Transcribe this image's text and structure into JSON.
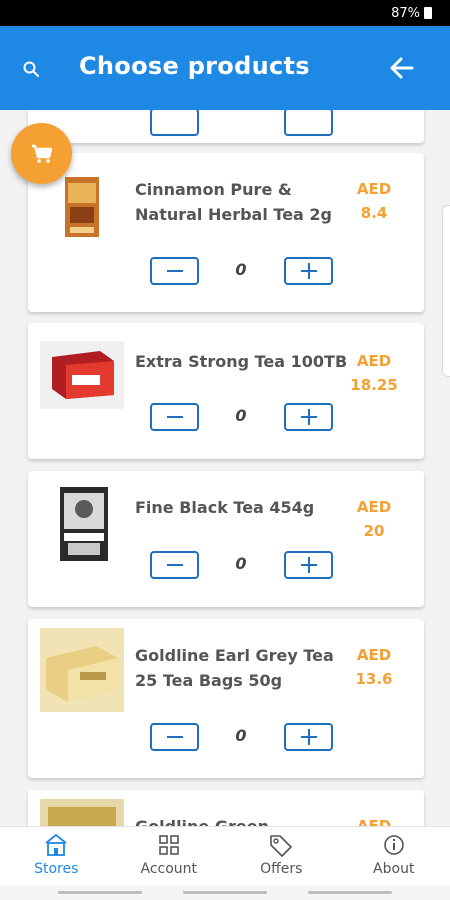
{
  "status_bar": {
    "battery": "87%"
  },
  "app_bar": {
    "title": "Choose products"
  },
  "colors": {
    "primary": "#1e88e5",
    "accent": "#f5a033",
    "button_border": "#1e6fc0"
  },
  "products": [
    {
      "name": "Cinnamon Pure & Natural Herbal Tea 2g",
      "currency": "AED",
      "price": "8.4",
      "quantity": "0"
    },
    {
      "name": "Extra Strong Tea 100TB",
      "currency": "AED",
      "price": "18.25",
      "quantity": "0"
    },
    {
      "name": "Fine Black Tea 454g",
      "currency": "AED",
      "price": "20",
      "quantity": "0"
    },
    {
      "name": "Goldline Earl Grey Tea 25 Tea Bags 50g",
      "currency": "AED",
      "price": "13.6",
      "quantity": "0"
    },
    {
      "name": "Goldline Green",
      "currency": "AED",
      "price": "",
      "quantity": ""
    }
  ],
  "bottom_nav": [
    {
      "label": "Stores",
      "icon": "store-icon",
      "active": true
    },
    {
      "label": "Account",
      "icon": "grid-icon",
      "active": false
    },
    {
      "label": "Offers",
      "icon": "tag-icon",
      "active": false
    },
    {
      "label": "About",
      "icon": "info-icon",
      "active": false
    }
  ]
}
